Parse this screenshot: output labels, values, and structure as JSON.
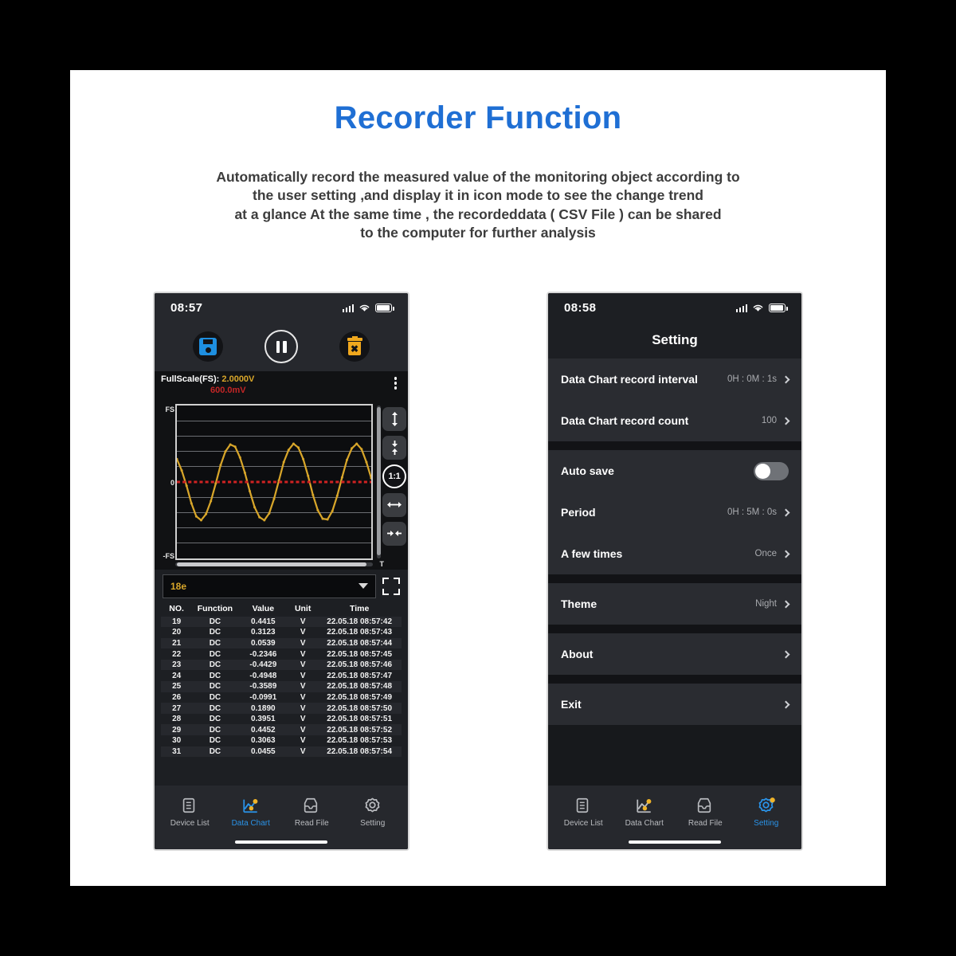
{
  "header": {
    "title": "Recorder Function",
    "description_lines": [
      "Automatically record the measured value of the monitoring object according to",
      "the user setting ,and display it in icon mode to see the change trend",
      "at a glance At the same time , the recordeddata ( CSV File ) can be shared",
      "to the computer for further analysis"
    ],
    "title_color": "#1f6fd4"
  },
  "phone_left": {
    "status": {
      "time": "08:57"
    },
    "toolbar": {
      "save_label": "save-record",
      "pause_label": "pause-record",
      "delete_label": "delete-record"
    },
    "fullscale": {
      "label": "FullScale(FS):",
      "value": "2.0000V",
      "sub_value": "600.0mV",
      "value_color": "#d8a62a",
      "sub_color": "#c32626"
    },
    "axis": {
      "top": "FS",
      "zero": "0",
      "bottom": "-FS",
      "time": "T"
    },
    "chart_controls": [
      {
        "name": "expand-vertical",
        "glyph": "↕"
      },
      {
        "name": "collapse-vertical",
        "glyph": "↥"
      },
      {
        "name": "ratio-one-to-one",
        "glyph": "1:1"
      },
      {
        "name": "expand-horizontal",
        "glyph": "↔"
      },
      {
        "name": "collapse-horizontal",
        "glyph": "⇥"
      }
    ],
    "dropdown": {
      "value": "18e"
    },
    "table": {
      "columns": [
        "NO.",
        "Function",
        "Value",
        "Unit",
        "Time"
      ],
      "rows": [
        [
          "19",
          "DC",
          "0.4415",
          "V",
          "22.05.18 08:57:42"
        ],
        [
          "20",
          "DC",
          "0.3123",
          "V",
          "22.05.18 08:57:43"
        ],
        [
          "21",
          "DC",
          "0.0539",
          "V",
          "22.05.18 08:57:44"
        ],
        [
          "22",
          "DC",
          "-0.2346",
          "V",
          "22.05.18 08:57:45"
        ],
        [
          "23",
          "DC",
          "-0.4429",
          "V",
          "22.05.18 08:57:46"
        ],
        [
          "24",
          "DC",
          "-0.4948",
          "V",
          "22.05.18 08:57:47"
        ],
        [
          "25",
          "DC",
          "-0.3589",
          "V",
          "22.05.18 08:57:48"
        ],
        [
          "26",
          "DC",
          "-0.0991",
          "V",
          "22.05.18 08:57:49"
        ],
        [
          "27",
          "DC",
          "0.1890",
          "V",
          "22.05.18 08:57:50"
        ],
        [
          "28",
          "DC",
          "0.3951",
          "V",
          "22.05.18 08:57:51"
        ],
        [
          "29",
          "DC",
          "0.4452",
          "V",
          "22.05.18 08:57:52"
        ],
        [
          "30",
          "DC",
          "0.3063",
          "V",
          "22.05.18 08:57:53"
        ],
        [
          "31",
          "DC",
          "0.0455",
          "V",
          "22.05.18 08:57:54"
        ]
      ]
    },
    "nav": [
      {
        "label": "Device List",
        "active": false
      },
      {
        "label": "Data Chart",
        "active": true
      },
      {
        "label": "Read File",
        "active": false
      },
      {
        "label": "Setting",
        "active": false
      }
    ]
  },
  "phone_right": {
    "status": {
      "time": "08:58"
    },
    "title": "Setting",
    "rows": [
      {
        "key": "Data Chart record interval",
        "value": "0H : 0M : 1s",
        "type": "chevron"
      },
      {
        "key": "Data Chart record count",
        "value": "100",
        "type": "chevron"
      },
      {
        "key": "Auto save",
        "value": "",
        "type": "toggle",
        "on": false
      },
      {
        "key": "Period",
        "value": "0H : 5M : 0s",
        "type": "chevron"
      },
      {
        "key": "A few times",
        "value": "Once",
        "type": "chevron"
      },
      {
        "key": "Theme",
        "value": "Night",
        "type": "chevron"
      },
      {
        "key": "About",
        "value": "",
        "type": "chevron"
      },
      {
        "key": "Exit",
        "value": "",
        "type": "chevron"
      }
    ],
    "nav": [
      {
        "label": "Device List",
        "active": false
      },
      {
        "label": "Data Chart",
        "active": false
      },
      {
        "label": "Read File",
        "active": false
      },
      {
        "label": "Setting",
        "active": true
      }
    ]
  },
  "chart_data": {
    "type": "line",
    "title": "FullScale(FS): 2.0000V / 600.0mV",
    "xlabel": "T",
    "ylabel": "",
    "ylim": [
      -1,
      1
    ],
    "ytick_labels": [
      "FS",
      "0",
      "-FS"
    ],
    "gridlines": 10,
    "series": [
      {
        "name": "DC measurement",
        "color": "#d8a62a",
        "style": "line-with-markers",
        "cycles": 3.5,
        "amplitude": 0.5,
        "values": [
          0.3,
          0.15,
          -0.05,
          -0.28,
          -0.45,
          -0.5,
          -0.42,
          -0.25,
          -0.02,
          0.22,
          0.4,
          0.49,
          0.46,
          0.32,
          0.12,
          -0.12,
          -0.33,
          -0.46,
          -0.5,
          -0.41,
          -0.22,
          0.02,
          0.26,
          0.42,
          0.5,
          0.45,
          0.3,
          0.08,
          -0.17,
          -0.37,
          -0.48,
          -0.49,
          -0.38,
          -0.18,
          0.06,
          0.29,
          0.44,
          0.5,
          0.43,
          0.26,
          0.05
        ]
      },
      {
        "name": "zero-reference",
        "color": "#cf2222",
        "style": "dashed",
        "values": [
          0
        ]
      }
    ]
  }
}
